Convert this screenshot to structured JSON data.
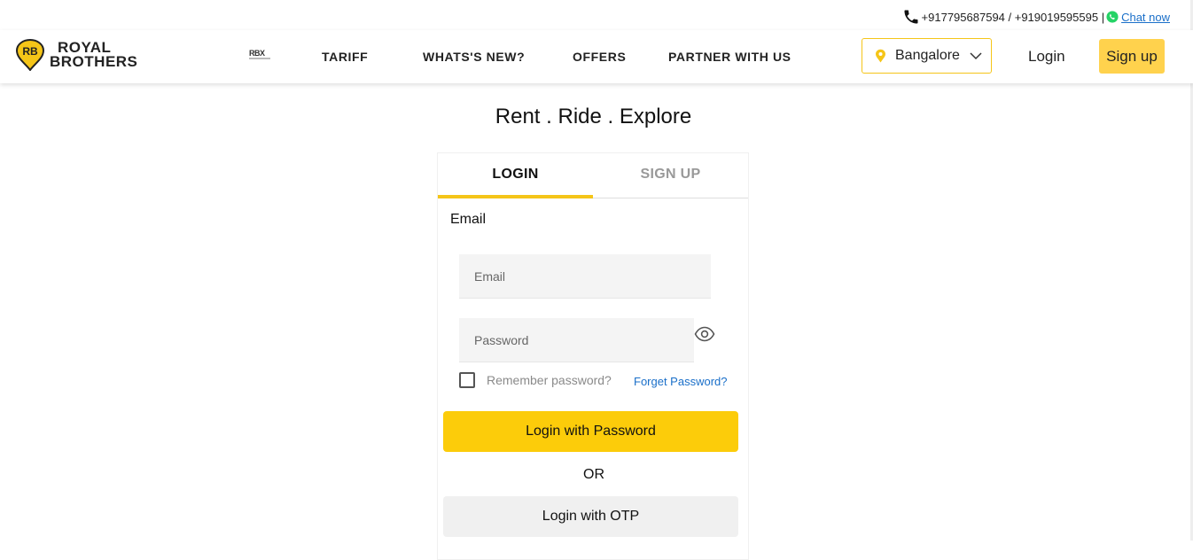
{
  "contact": {
    "phones": "+917795687594 / +919019595595 |",
    "chat_label": "Chat now"
  },
  "brand": {
    "logo_mark": "RB",
    "name_line1": "ROYAL",
    "name_line2": "BROTHERS",
    "rbx_mark": "RBX"
  },
  "nav": {
    "items": [
      {
        "label": "TARIFF"
      },
      {
        "label": "WHATS'S NEW?"
      },
      {
        "label": "OFFERS"
      },
      {
        "label": "PARTNER WITH US"
      }
    ],
    "city": "Bangalore",
    "login_label": "Login",
    "signup_label": "Sign up"
  },
  "hero": {
    "tagline": "Rent . Ride . Explore"
  },
  "auth_card": {
    "tabs": [
      {
        "label": "LOGIN",
        "active": true
      },
      {
        "label": "SIGN UP",
        "active": false
      }
    ],
    "email_label": "Email",
    "email_placeholder": "Email",
    "password_placeholder": "Password",
    "remember_label": "Remember password?",
    "remember_checked": false,
    "forgot_label": "Forget Password?",
    "login_password_label": "Login with Password",
    "or_label": "OR",
    "login_otp_label": "Login with OTP"
  },
  "colors": {
    "accent": "#f5c518",
    "primary_button": "#fccc0a",
    "signup_button": "#ffd24d",
    "link": "#1a6fc9",
    "whatsapp": "#25d366"
  },
  "icons": [
    "phone-icon",
    "whatsapp-icon",
    "location-pin-icon",
    "chevron-down-icon",
    "eye-icon"
  ]
}
